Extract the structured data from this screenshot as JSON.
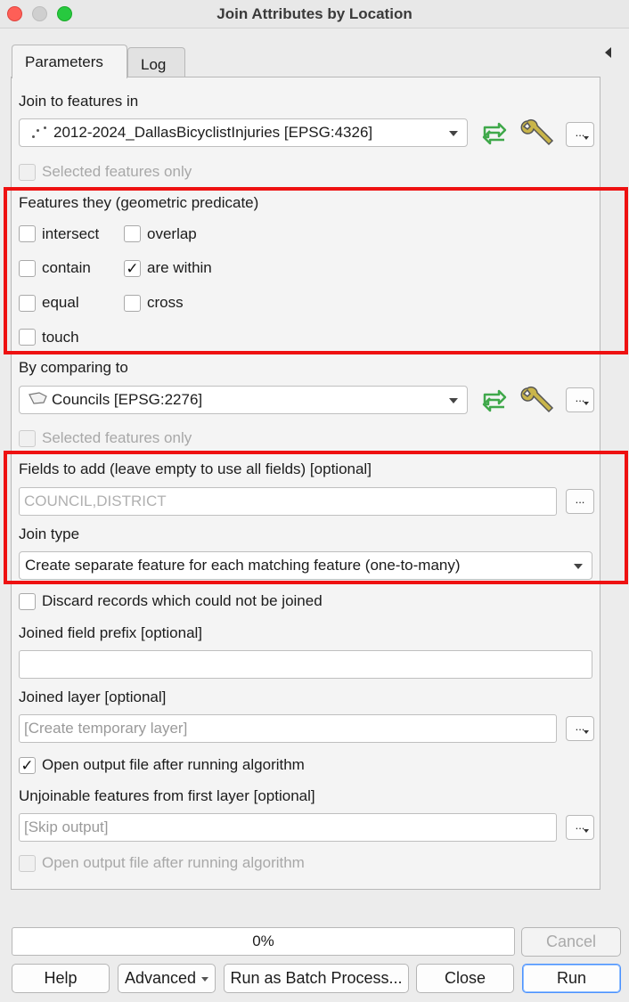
{
  "window": {
    "title": "Join Attributes by Location"
  },
  "tabs": [
    {
      "label": "Parameters"
    },
    {
      "label": "Log"
    }
  ],
  "join_to": {
    "label": "Join to features in",
    "value": "2012-2024_DallasBicyclistInjuries [EPSG:4326]",
    "selected_only": {
      "label": "Selected features only",
      "checked": false
    }
  },
  "predicate": {
    "label": "Features they (geometric predicate)",
    "options": [
      {
        "label": "intersect",
        "checked": false
      },
      {
        "label": "overlap",
        "checked": false
      },
      {
        "label": "contain",
        "checked": false
      },
      {
        "label": "are within",
        "checked": true
      },
      {
        "label": "equal",
        "checked": false
      },
      {
        "label": "cross",
        "checked": false
      },
      {
        "label": "touch",
        "checked": false
      }
    ]
  },
  "comparing": {
    "label": "By comparing to",
    "value": "Councils [EPSG:2276]",
    "selected_only": {
      "label": "Selected features only",
      "checked": false
    }
  },
  "fields": {
    "label": "Fields to add (leave empty to use all fields) [optional]",
    "value": "COUNCIL,DISTRICT",
    "button": "..."
  },
  "join_type": {
    "label": "Join type",
    "value": "Create separate feature for each matching feature (one-to-many)"
  },
  "discard": {
    "label": "Discard records which could not be joined",
    "checked": false
  },
  "prefix": {
    "label": "Joined field prefix [optional]",
    "value": ""
  },
  "joined_layer": {
    "label": "Joined layer [optional]",
    "placeholder": "[Create temporary layer]",
    "open_output": {
      "label": "Open output file after running algorithm",
      "checked": true
    }
  },
  "unjoinable": {
    "label": "Unjoinable features from first layer [optional]",
    "placeholder": "[Skip output]",
    "open_output": {
      "label": "Open output file after running algorithm",
      "checked": false
    }
  },
  "progress": {
    "text": "0%",
    "value": 0
  },
  "buttons": {
    "cancel": "Cancel",
    "help": "Help",
    "advanced": "Advanced",
    "batch": "Run as Batch Process...",
    "close": "Close",
    "run": "Run",
    "dots": "..."
  },
  "colors": {
    "highlight": "#ee1111",
    "iterate_icon": "#3fa84a",
    "run_focus": "#4b92ff"
  },
  "icons": [
    "point-layer-icon",
    "polygon-layer-icon",
    "iterate-icon",
    "wrench-icon",
    "chevron-down-icon",
    "checkmark-icon",
    "collapse-arrow-icon"
  ]
}
